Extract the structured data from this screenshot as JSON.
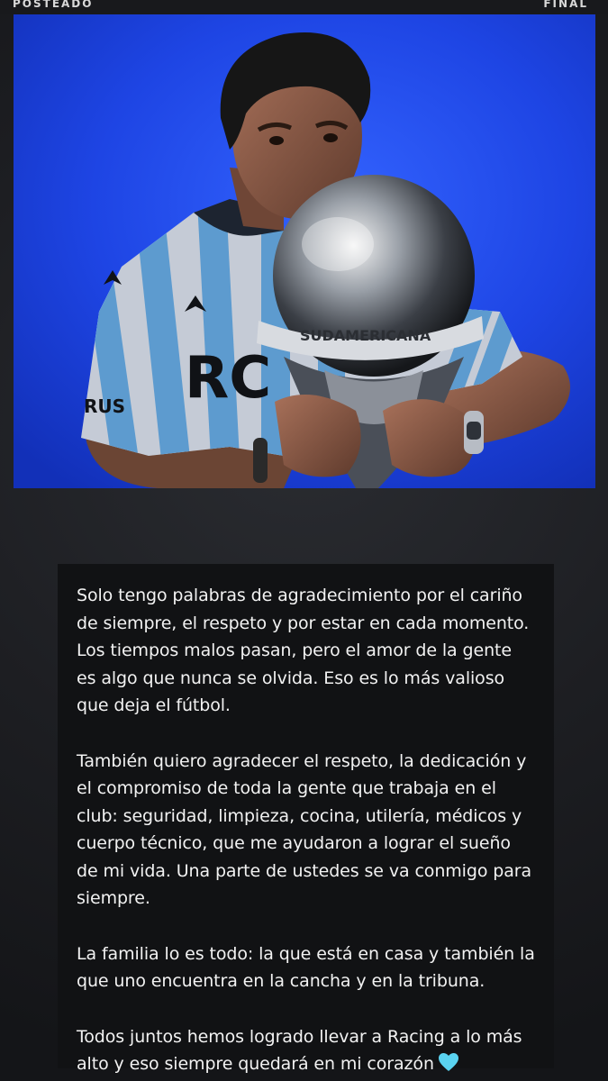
{
  "header": {
    "left_label": "POSTEADO",
    "right_label": "FINAL"
  },
  "photo": {
    "trophy_inscription": "SUDAMERICANA",
    "shirt_sponsor": "RUS",
    "shirt_text": "RC",
    "background_color": "#1f44e6"
  },
  "message": {
    "paragraphs": [
      "Solo tengo palabras de agradecimiento por el cariño de siempre, el respeto y por estar en cada momento. Los tiempos malos pasan, pero el amor de la gente es algo que nunca se olvida. Eso es lo más valioso que deja el fútbol.",
      "También quiero agradecer el respeto, la dedicación y el compromiso de toda la gente que trabaja en el club: seguridad, limpieza, cocina, utilería, médicos y cuerpo técnico, que me ayudaron a lograr el sueño de mi vida. Una parte de ustedes se va conmigo para siempre.",
      "La familia lo es todo: la que está en casa y también la que uno encuentra en la cancha y en la tribuna.",
      "Todos juntos hemos logrado llevar a Racing a lo más alto y eso siempre quedará en mi corazón"
    ],
    "heart_icon": "light-blue-heart-icon",
    "heart_color": "#5ad3f0"
  }
}
